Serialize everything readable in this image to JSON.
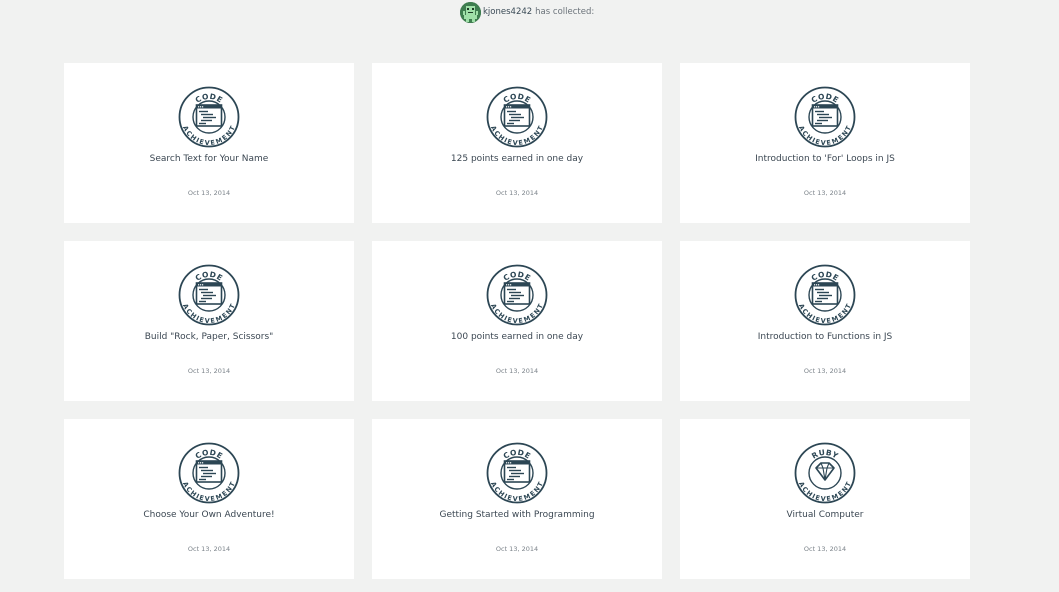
{
  "header": {
    "username": "kjones4242",
    "collected_text": "has collected:"
  },
  "colors": {
    "background": "#f1f2f1",
    "card": "#ffffff",
    "badge": "#2c4654",
    "avatar": "#3e7d4f"
  },
  "achievements": [
    {
      "badge_type": "CODE",
      "badge_bottom": "ACHIEVEMENT",
      "icon": "code-window-icon",
      "title": "Search Text for Your Name",
      "date": "Oct 13, 2014"
    },
    {
      "badge_type": "CODE",
      "badge_bottom": "ACHIEVEMENT",
      "icon": "code-window-icon",
      "title": "125 points earned in one day",
      "date": "Oct 13, 2014"
    },
    {
      "badge_type": "CODE",
      "badge_bottom": "ACHIEVEMENT",
      "icon": "code-window-icon",
      "title": "Introduction to 'For' Loops in JS",
      "date": "Oct 13, 2014"
    },
    {
      "badge_type": "CODE",
      "badge_bottom": "ACHIEVEMENT",
      "icon": "code-window-icon",
      "title": "Build \"Rock, Paper, Scissors\"",
      "date": "Oct 13, 2014"
    },
    {
      "badge_type": "CODE",
      "badge_bottom": "ACHIEVEMENT",
      "icon": "code-window-icon",
      "title": "100 points earned in one day",
      "date": "Oct 13, 2014"
    },
    {
      "badge_type": "CODE",
      "badge_bottom": "ACHIEVEMENT",
      "icon": "code-window-icon",
      "title": "Introduction to Functions in JS",
      "date": "Oct 13, 2014"
    },
    {
      "badge_type": "CODE",
      "badge_bottom": "ACHIEVEMENT",
      "icon": "code-window-icon",
      "title": "Choose Your Own Adventure!",
      "date": "Oct 13, 2014"
    },
    {
      "badge_type": "CODE",
      "badge_bottom": "ACHIEVEMENT",
      "icon": "code-window-icon",
      "title": "Getting Started with Programming",
      "date": "Oct 13, 2014"
    },
    {
      "badge_type": "RUBY",
      "badge_bottom": "ACHIEVEMENT",
      "icon": "ruby-gem-icon",
      "title": "Virtual Computer",
      "date": "Oct 13, 2014"
    }
  ]
}
